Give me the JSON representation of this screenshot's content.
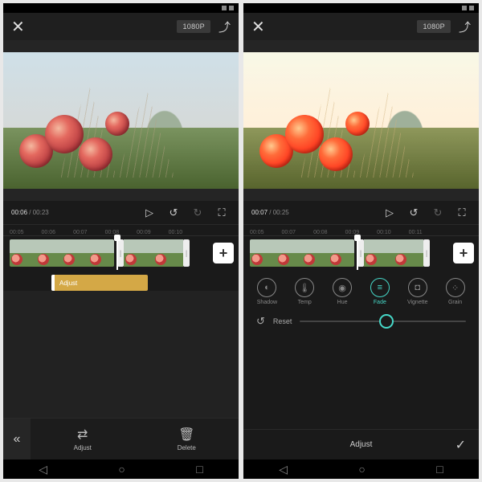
{
  "left": {
    "resolution": "1080P",
    "time_current": "00:06",
    "time_total": "00:23",
    "ruler": [
      "00:05",
      "00:06",
      "00:07",
      "00:08",
      "00:09",
      "00:10"
    ],
    "effect_label": "Adjust",
    "bottom": {
      "adjust": "Adjust",
      "delete": "Delete"
    }
  },
  "right": {
    "resolution": "1080P",
    "time_current": "00:07",
    "time_total": "00:25",
    "ruler": [
      "00:05",
      "00:07",
      "00:08",
      "00:09",
      "00:10",
      "00:11"
    ],
    "adjust_opts": {
      "shadow": "Shadow",
      "temp": "Temp",
      "hue": "Hue",
      "fade": "Fade",
      "vignette": "Vignette",
      "grain": "Grain"
    },
    "reset": "Reset",
    "confirm_label": "Adjust"
  }
}
